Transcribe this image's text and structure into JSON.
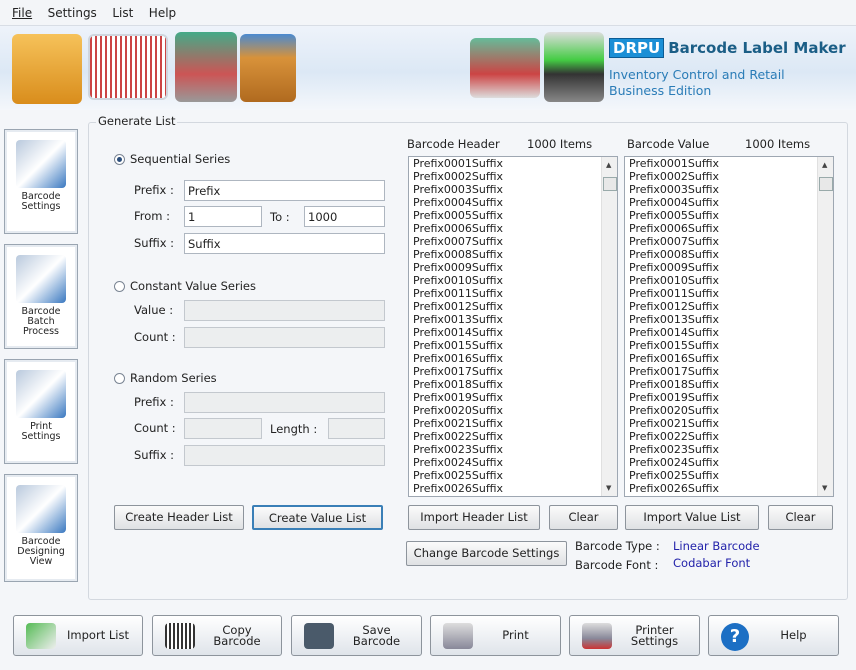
{
  "menu": [
    "File",
    "Settings",
    "List",
    "Help"
  ],
  "brand": {
    "logo": "DRPU",
    "title": "Barcode Label Maker",
    "subtitle1": "Inventory Control and Retail",
    "subtitle2": "Business Edition"
  },
  "sidebar": [
    {
      "label": "Barcode Settings",
      "icon": "barcode-settings-icon"
    },
    {
      "label": "Barcode Batch Process",
      "icon": "batch-process-icon"
    },
    {
      "label": "Print Settings",
      "icon": "print-settings-icon"
    },
    {
      "label": "Barcode Designing View",
      "icon": "designing-view-icon"
    }
  ],
  "generate": {
    "title": "Generate List",
    "sequential": {
      "label": "Sequential Series",
      "selected": true,
      "prefix_label": "Prefix :",
      "prefix": "Prefix",
      "from_label": "From :",
      "from": "1",
      "to_label": "To :",
      "to": "1000",
      "suffix_label": "Suffix :",
      "suffix": "Suffix"
    },
    "constant": {
      "label": "Constant Value Series",
      "selected": false,
      "value_label": "Value :",
      "count_label": "Count :"
    },
    "random": {
      "label": "Random Series",
      "selected": false,
      "prefix_label": "Prefix :",
      "count_label": "Count :",
      "length_label": "Length :",
      "suffix_label": "Suffix :"
    },
    "create_header": "Create Header List",
    "create_value": "Create Value List"
  },
  "header_list": {
    "title": "Barcode Header",
    "count": "1000 Items",
    "items": [
      "Prefix0001Suffix",
      "Prefix0002Suffix",
      "Prefix0003Suffix",
      "Prefix0004Suffix",
      "Prefix0005Suffix",
      "Prefix0006Suffix",
      "Prefix0007Suffix",
      "Prefix0008Suffix",
      "Prefix0009Suffix",
      "Prefix0010Suffix",
      "Prefix0011Suffix",
      "Prefix0012Suffix",
      "Prefix0013Suffix",
      "Prefix0014Suffix",
      "Prefix0015Suffix",
      "Prefix0016Suffix",
      "Prefix0017Suffix",
      "Prefix0018Suffix",
      "Prefix0019Suffix",
      "Prefix0020Suffix",
      "Prefix0021Suffix",
      "Prefix0022Suffix",
      "Prefix0023Suffix",
      "Prefix0024Suffix",
      "Prefix0025Suffix",
      "Prefix0026Suffix"
    ],
    "import": "Import Header List",
    "clear": "Clear"
  },
  "value_list": {
    "title": "Barcode Value",
    "count": "1000 Items",
    "items": [
      "Prefix0001Suffix",
      "Prefix0002Suffix",
      "Prefix0003Suffix",
      "Prefix0004Suffix",
      "Prefix0005Suffix",
      "Prefix0006Suffix",
      "Prefix0007Suffix",
      "Prefix0008Suffix",
      "Prefix0009Suffix",
      "Prefix0010Suffix",
      "Prefix0011Suffix",
      "Prefix0012Suffix",
      "Prefix0013Suffix",
      "Prefix0014Suffix",
      "Prefix0015Suffix",
      "Prefix0016Suffix",
      "Prefix0017Suffix",
      "Prefix0018Suffix",
      "Prefix0019Suffix",
      "Prefix0020Suffix",
      "Prefix0021Suffix",
      "Prefix0022Suffix",
      "Prefix0023Suffix",
      "Prefix0024Suffix",
      "Prefix0025Suffix",
      "Prefix0026Suffix"
    ],
    "import": "Import Value List",
    "clear": "Clear"
  },
  "barcode_info": {
    "change": "Change Barcode Settings",
    "type_label": "Barcode Type :",
    "type": "Linear Barcode",
    "font_label": "Barcode Font :",
    "font": "Codabar Font"
  },
  "bottom": [
    {
      "label": "Import List",
      "icon": "import-list-icon"
    },
    {
      "label": "Copy Barcode",
      "icon": "copy-barcode-icon"
    },
    {
      "label": "Save Barcode",
      "icon": "save-icon"
    },
    {
      "label": "Print",
      "icon": "printer-icon"
    },
    {
      "label": "Printer Settings",
      "icon": "printer-settings-icon"
    },
    {
      "label": "Help",
      "icon": "help-icon"
    }
  ]
}
